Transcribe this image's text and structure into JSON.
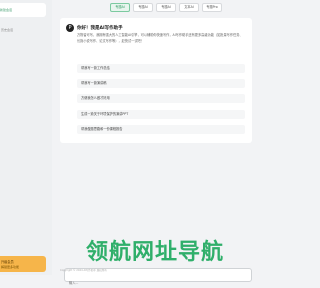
{
  "sidebar": {
    "active_label": "新建会话",
    "item_label": "历史会话",
    "footer_line1": "升级会员",
    "footer_line2": "解锁更多功能"
  },
  "tabs": [
    {
      "label": "专题AI",
      "active": true
    },
    {
      "label": "专题AI",
      "active": false
    },
    {
      "label": "专题AI",
      "active": false
    },
    {
      "label": "文本AI",
      "active": false
    },
    {
      "label": "专题Pro",
      "active": false
    }
  ],
  "chat": {
    "logo_char": "P",
    "title": "你好！我是AI写作助手",
    "intro": "万物皆可写，我拥有强大的人工智能AI引擎，可以辅助你快速写作，AI写作助手还有更多高级功能（如批量写作任务、长篇小说写作、论文写作等），赶快试一试吧！",
    "suggestions": [
      "帮我写一篇工作总结",
      "帮我写一篇演讲稿",
      "方便我怎么做才好用",
      "生成一篇关于环境保护的演讲PPT",
      "帮我做题思路和一份课程报告"
    ]
  },
  "input": {
    "placeholder": "输入..."
  },
  "watermark": "领航网址导航",
  "footer": "Copyright © 2024 AI写作助手 版权所有"
}
